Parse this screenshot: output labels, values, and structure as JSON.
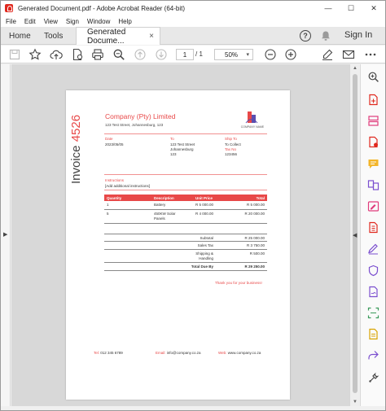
{
  "window": {
    "title": "Generated Document.pdf - Adobe Acrobat Reader (64-bit)",
    "min": "—",
    "max": "☐",
    "close": "✕"
  },
  "menu": [
    "File",
    "Edit",
    "View",
    "Sign",
    "Window",
    "Help"
  ],
  "tabs": {
    "home": "Home",
    "tools": "Tools",
    "doc": "Generated Docume...",
    "close": "×"
  },
  "header": {
    "help": "?",
    "signin": "Sign In"
  },
  "toolbar": {
    "page_current": "1",
    "page_total": "/ 1",
    "zoom": "50%",
    "zoom_caret": "▾"
  },
  "invoice": {
    "title_word": "Invoice",
    "number": "4526",
    "company": "Company (Pty) Limited",
    "address": "123 Test Street, Johannesburg, 123",
    "logo_text": "COMPANY NAME",
    "date_label": "Date",
    "date_value": "2023/05/05",
    "to_label": "To",
    "to_lines": [
      "123 Test Street",
      "Johannesburg",
      "123"
    ],
    "shipto_label": "Ship To",
    "shipto_value": "To Collect",
    "taxno_label": "Tax No",
    "taxno_value": "123456",
    "instructions_label": "Instructions",
    "instructions_value": "[Add additional instructions]",
    "table_headers": [
      "Quantity",
      "Description",
      "Unit Price",
      "Total"
    ],
    "rows": [
      {
        "qty": "1",
        "desc": "Battery",
        "unit": "R 5 000.00",
        "total": "R 5 000.00"
      },
      {
        "qty": "5",
        "desc_line1": "450KW Solar",
        "desc_line2": "Panels",
        "unit": "R 4 000.00",
        "total": "R 20 000.00"
      }
    ],
    "subtotal_label": "Subtotal",
    "subtotal_value": "R 25 000.00",
    "tax_label": "Sales Tax",
    "tax_value": "R 3 750.00",
    "shipping_label_1": "Shipping &",
    "shipping_label_2": "Handling",
    "shipping_value": "R 500.00",
    "total_label": "Total Due By",
    "total_value": "R 29 250.00",
    "thanks": "Thank you for your business!",
    "footer": {
      "tel_k": "Tel:",
      "tel_v": "012 345 6789",
      "email_k": "Email:",
      "email_v": "info@company.co.za",
      "web_k": "Web:",
      "web_v": "www.company.co.za"
    }
  },
  "colors": {
    "accent": "#e84848",
    "acrobat_red": "#e0281e"
  }
}
